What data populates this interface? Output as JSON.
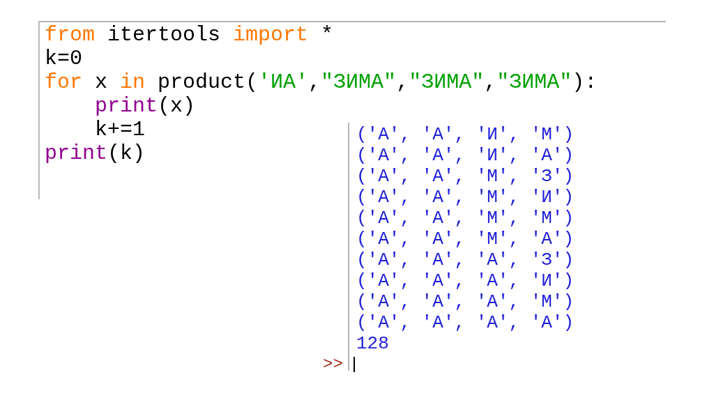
{
  "editor": {
    "lines": [
      {
        "indented": false,
        "tokens": [
          {
            "kind": "keyword",
            "text": "from"
          },
          {
            "kind": "plain",
            "text": " itertools "
          },
          {
            "kind": "keyword",
            "text": "import"
          },
          {
            "kind": "plain",
            "text": " *"
          }
        ]
      },
      {
        "indented": false,
        "tokens": [
          {
            "kind": "plain",
            "text": "k=0"
          }
        ]
      },
      {
        "indented": false,
        "tokens": [
          {
            "kind": "keyword",
            "text": "for"
          },
          {
            "kind": "plain",
            "text": " x "
          },
          {
            "kind": "keyword",
            "text": "in"
          },
          {
            "kind": "plain",
            "text": " product("
          },
          {
            "kind": "string",
            "text": "'ИА'"
          },
          {
            "kind": "plain",
            "text": ","
          },
          {
            "kind": "string",
            "text": "\"ЗИМА\""
          },
          {
            "kind": "plain",
            "text": ","
          },
          {
            "kind": "string",
            "text": "\"ЗИМА\""
          },
          {
            "kind": "plain",
            "text": ","
          },
          {
            "kind": "string",
            "text": "\"ЗИМА\""
          },
          {
            "kind": "plain",
            "text": "):"
          }
        ]
      },
      {
        "indented": true,
        "tokens": [
          {
            "kind": "builtin",
            "text": "print"
          },
          {
            "kind": "plain",
            "text": "(x)"
          }
        ]
      },
      {
        "indented": true,
        "tokens": [
          {
            "kind": "plain",
            "text": "k+=1"
          }
        ]
      },
      {
        "indented": false,
        "tokens": [
          {
            "kind": "builtin",
            "text": "print"
          },
          {
            "kind": "plain",
            "text": "(k)"
          }
        ]
      }
    ]
  },
  "shell": {
    "output": [
      "('А', 'А', 'И', 'М')",
      "('А', 'А', 'И', 'А')",
      "('А', 'А', 'М', 'З')",
      "('А', 'А', 'М', 'И')",
      "('А', 'А', 'М', 'М')",
      "('А', 'А', 'М', 'А')",
      "('А', 'А', 'А', 'З')",
      "('А', 'А', 'А', 'И')",
      "('А', 'А', 'А', 'М')",
      "('А', 'А', 'А', 'А')",
      "128"
    ],
    "prompt": ">>"
  }
}
